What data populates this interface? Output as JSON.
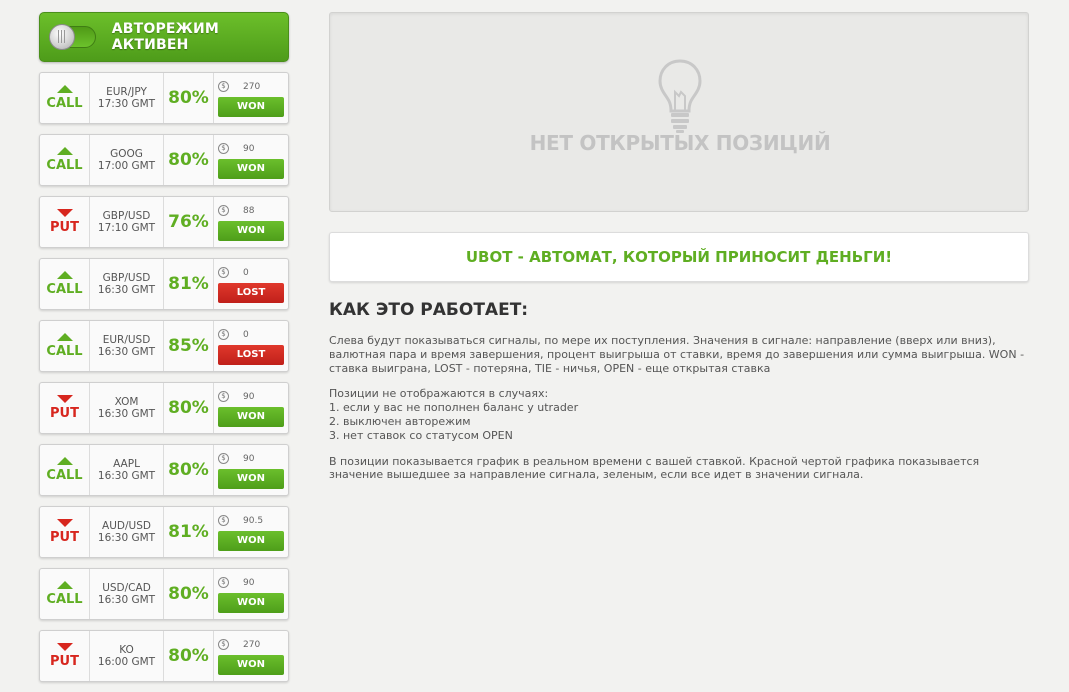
{
  "autoMode": {
    "label": "АВТОРЕЖИМ АКТИВЕН"
  },
  "signals": [
    {
      "direction": "CALL",
      "asset": "EUR/JPY",
      "time": "17:30 GMT",
      "percent": "80%",
      "amount": "270",
      "result": "WON"
    },
    {
      "direction": "CALL",
      "asset": "GOOG",
      "time": "17:00 GMT",
      "percent": "80%",
      "amount": "90",
      "result": "WON"
    },
    {
      "direction": "PUT",
      "asset": "GBP/USD",
      "time": "17:10 GMT",
      "percent": "76%",
      "amount": "88",
      "result": "WON"
    },
    {
      "direction": "CALL",
      "asset": "GBP/USD",
      "time": "16:30 GMT",
      "percent": "81%",
      "amount": "0",
      "result": "LOST"
    },
    {
      "direction": "CALL",
      "asset": "EUR/USD",
      "time": "16:30 GMT",
      "percent": "85%",
      "amount": "0",
      "result": "LOST"
    },
    {
      "direction": "PUT",
      "asset": "XOM",
      "time": "16:30 GMT",
      "percent": "80%",
      "amount": "90",
      "result": "WON"
    },
    {
      "direction": "CALL",
      "asset": "AAPL",
      "time": "16:30 GMT",
      "percent": "80%",
      "amount": "90",
      "result": "WON"
    },
    {
      "direction": "PUT",
      "asset": "AUD/USD",
      "time": "16:30 GMT",
      "percent": "81%",
      "amount": "90.5",
      "result": "WON"
    },
    {
      "direction": "CALL",
      "asset": "USD/CAD",
      "time": "16:30 GMT",
      "percent": "80%",
      "amount": "90",
      "result": "WON"
    },
    {
      "direction": "PUT",
      "asset": "KO",
      "time": "16:00 GMT",
      "percent": "80%",
      "amount": "270",
      "result": "WON"
    }
  ],
  "coinSymbol": "$",
  "noPositions": {
    "text": "НЕТ ОТКРЫТЫХ ПОЗИЦИЙ",
    "icon": "lightbulb-icon"
  },
  "banner": {
    "text": "UBOT - АВТОМАТ, КОТОРЫЙ ПРИНОСИТ ДЕНЬГИ!"
  },
  "howItWorks": {
    "title": "КАК ЭТО РАБОТАЕТ:",
    "para1": "Слева будут показываться сигналы, по мере их поступления. Значения в сигнале: направление (вверх или вниз), валютная пара и время завершения, процент выигрыша от ставки, время до завершения или сумма выигрыша. WON - ставка выиграна, LOST - потеряна, TIE - ничья, OPEN - еще открытая ставка",
    "listIntro": "Позиции не отображаются в случаях:",
    "list": [
      "1. если у вас не пополнен баланс у utrader",
      "2. выключен авторежим",
      "3. нет ставок со статусом OPEN"
    ],
    "para2": "В позиции показывается график в реальном времени с вашей ставкой. Красной чертой графика показывается значение вышедшее за направление сигнала, зеленым, если все идет в значении сигнала."
  },
  "colors": {
    "green": "#5fae22",
    "red": "#d7261e",
    "background": "#f2f2f0"
  }
}
